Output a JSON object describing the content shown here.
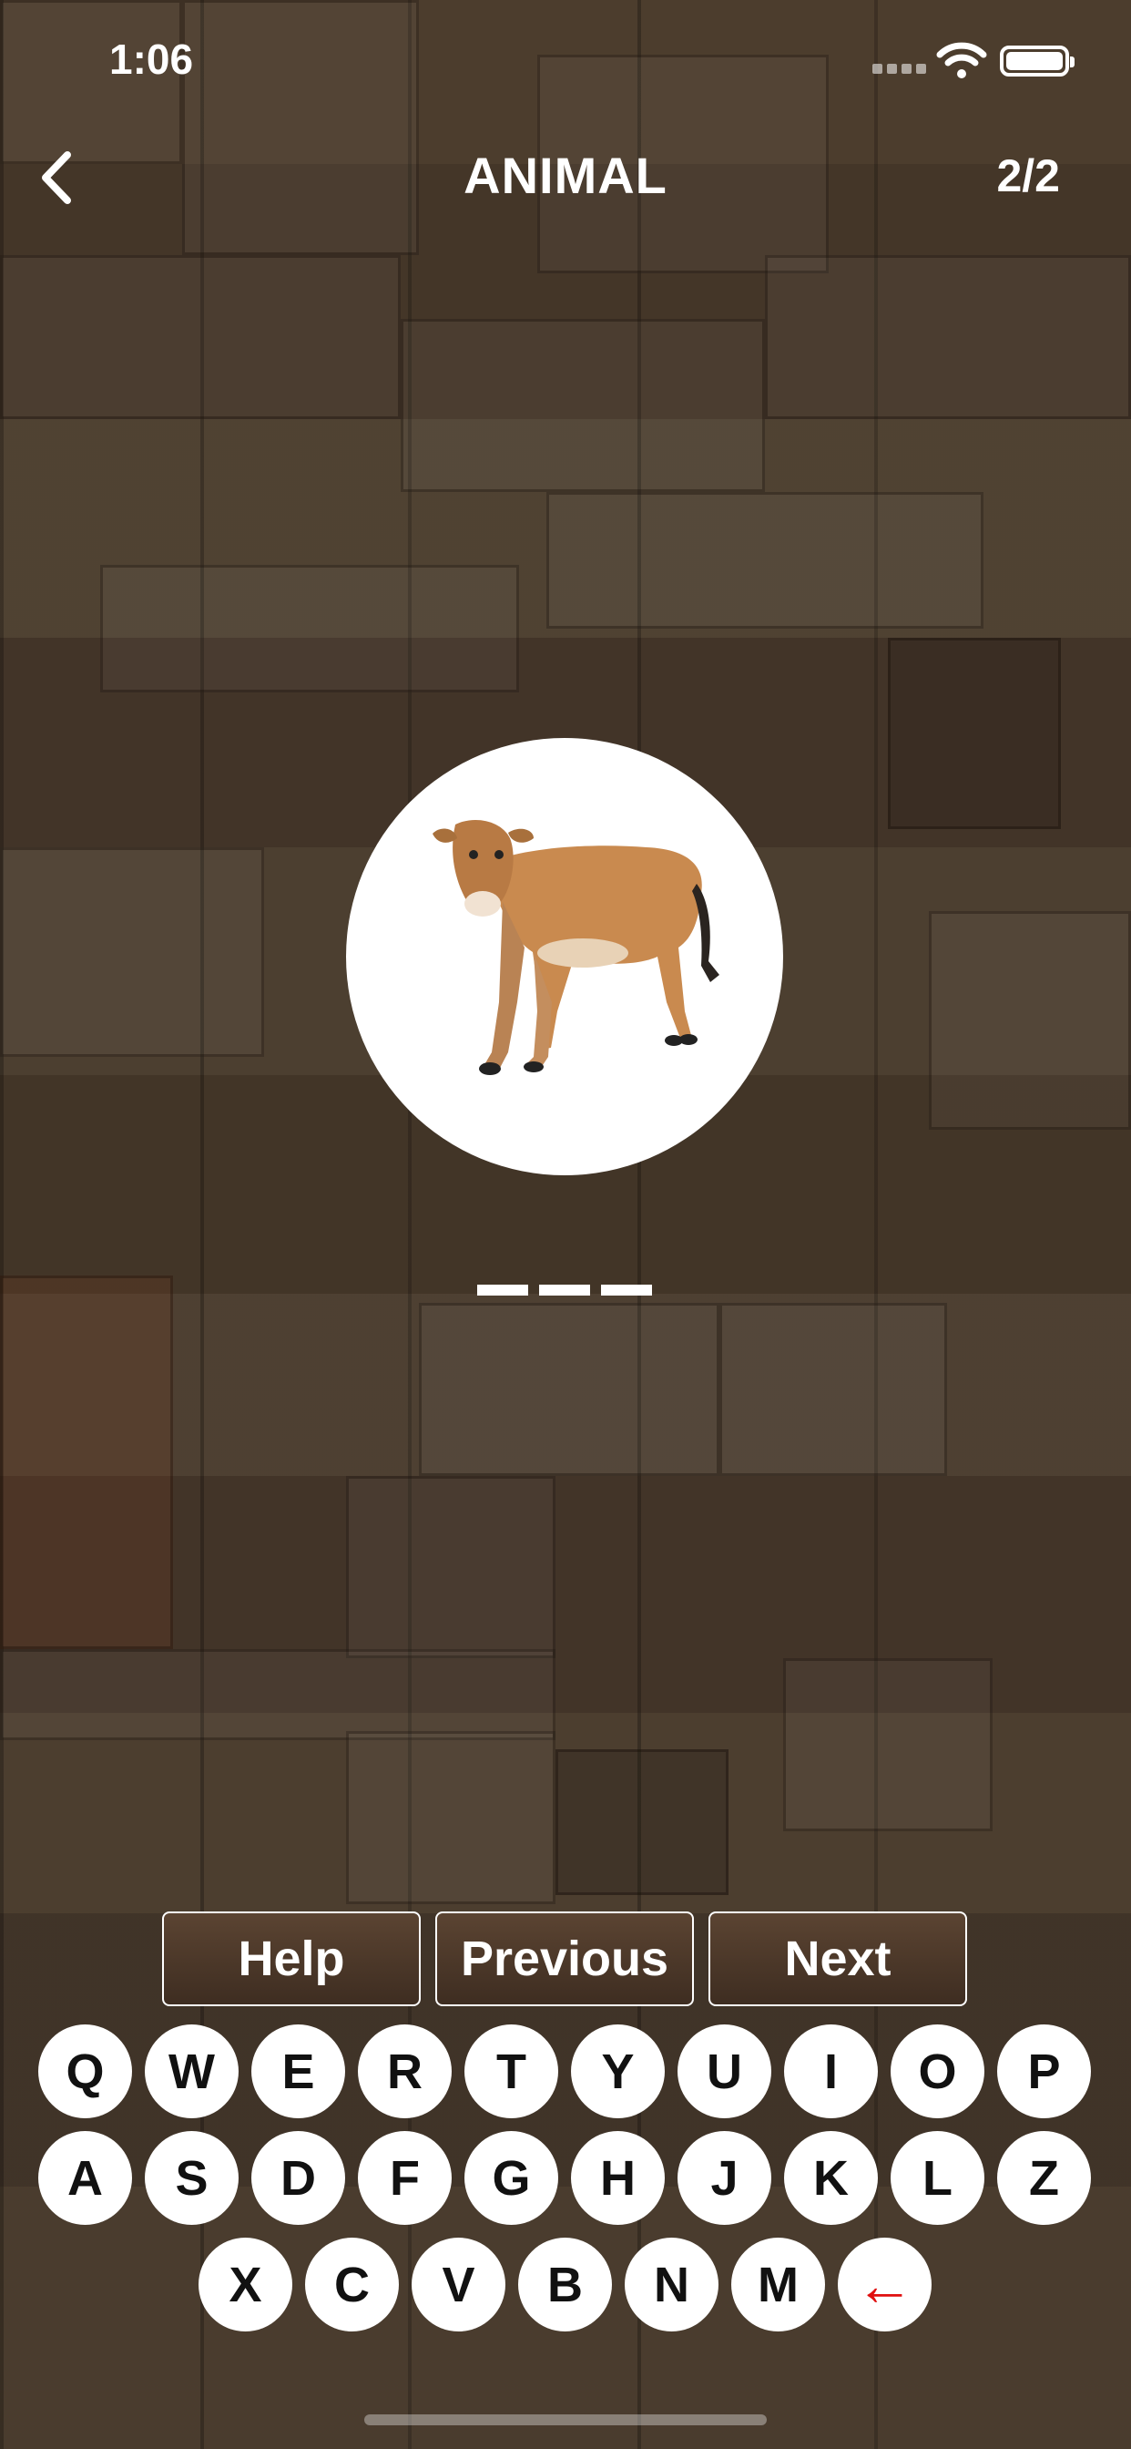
{
  "status_bar": {
    "time": "1:06",
    "icons": [
      "signal-icon",
      "wifi-icon",
      "battery-icon"
    ]
  },
  "nav": {
    "back_icon": "chevron-left-icon",
    "title": "ANIMAL",
    "counter": "2/2"
  },
  "puzzle": {
    "image": "cow-image",
    "slots": [
      "",
      "",
      ""
    ]
  },
  "actions": {
    "help": "Help",
    "previous": "Previous",
    "next": "Next"
  },
  "keyboard": {
    "row1": [
      "Q",
      "W",
      "E",
      "R",
      "T",
      "Y",
      "U",
      "I",
      "O",
      "P"
    ],
    "row2": [
      "A",
      "S",
      "D",
      "F",
      "G",
      "H",
      "J",
      "K",
      "L",
      "Z"
    ],
    "row3": [
      "X",
      "C",
      "V",
      "B",
      "N",
      "M"
    ],
    "backspace": "←"
  },
  "colors": {
    "backspace": "#e01010",
    "key_background": "#ffffff",
    "button_background": "#4a3727"
  }
}
